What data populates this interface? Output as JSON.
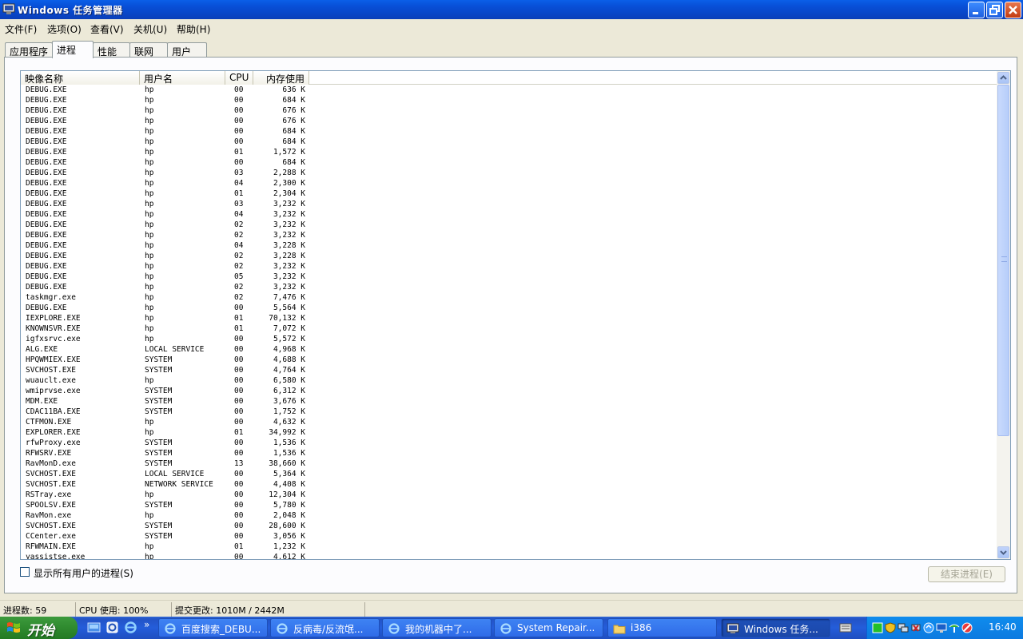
{
  "window": {
    "title": "Windows 任务管理器",
    "controls": [
      "minimize",
      "restore",
      "close"
    ]
  },
  "menu": [
    {
      "label": "文件(F)"
    },
    {
      "label": "选项(O)"
    },
    {
      "label": "查看(V)"
    },
    {
      "label": "关机(U)"
    },
    {
      "label": "帮助(H)"
    }
  ],
  "tabs": [
    {
      "label": "应用程序",
      "active": false
    },
    {
      "label": "进程",
      "active": true
    },
    {
      "label": "性能",
      "active": false
    },
    {
      "label": "联网",
      "active": false
    },
    {
      "label": "用户",
      "active": false
    }
  ],
  "process_table": {
    "columns": [
      "映像名称",
      "用户名",
      "CPU",
      "内存使用"
    ],
    "rows": [
      [
        "DEBUG.EXE",
        "hp",
        "00",
        "636 K"
      ],
      [
        "DEBUG.EXE",
        "hp",
        "00",
        "684 K"
      ],
      [
        "DEBUG.EXE",
        "hp",
        "00",
        "676 K"
      ],
      [
        "DEBUG.EXE",
        "hp",
        "00",
        "676 K"
      ],
      [
        "DEBUG.EXE",
        "hp",
        "00",
        "684 K"
      ],
      [
        "DEBUG.EXE",
        "hp",
        "00",
        "684 K"
      ],
      [
        "DEBUG.EXE",
        "hp",
        "01",
        "1,572 K"
      ],
      [
        "DEBUG.EXE",
        "hp",
        "00",
        "684 K"
      ],
      [
        "DEBUG.EXE",
        "hp",
        "03",
        "2,288 K"
      ],
      [
        "DEBUG.EXE",
        "hp",
        "04",
        "2,300 K"
      ],
      [
        "DEBUG.EXE",
        "hp",
        "01",
        "2,304 K"
      ],
      [
        "DEBUG.EXE",
        "hp",
        "03",
        "3,232 K"
      ],
      [
        "DEBUG.EXE",
        "hp",
        "04",
        "3,232 K"
      ],
      [
        "DEBUG.EXE",
        "hp",
        "02",
        "3,232 K"
      ],
      [
        "DEBUG.EXE",
        "hp",
        "02",
        "3,232 K"
      ],
      [
        "DEBUG.EXE",
        "hp",
        "04",
        "3,228 K"
      ],
      [
        "DEBUG.EXE",
        "hp",
        "02",
        "3,228 K"
      ],
      [
        "DEBUG.EXE",
        "hp",
        "02",
        "3,232 K"
      ],
      [
        "DEBUG.EXE",
        "hp",
        "05",
        "3,232 K"
      ],
      [
        "DEBUG.EXE",
        "hp",
        "02",
        "3,232 K"
      ],
      [
        "taskmgr.exe",
        "hp",
        "02",
        "7,476 K"
      ],
      [
        "DEBUG.EXE",
        "hp",
        "00",
        "5,564 K"
      ],
      [
        "IEXPLORE.EXE",
        "hp",
        "01",
        "70,132 K"
      ],
      [
        "KNOWNSVR.EXE",
        "hp",
        "01",
        "7,072 K"
      ],
      [
        "igfxsrvc.exe",
        "hp",
        "00",
        "5,572 K"
      ],
      [
        "ALG.EXE",
        "LOCAL SERVICE",
        "00",
        "4,968 K"
      ],
      [
        "HPQWMIEX.EXE",
        "SYSTEM",
        "00",
        "4,688 K"
      ],
      [
        "SVCHOST.EXE",
        "SYSTEM",
        "00",
        "4,764 K"
      ],
      [
        "wuauclt.exe",
        "hp",
        "00",
        "6,580 K"
      ],
      [
        "wmiprvse.exe",
        "SYSTEM",
        "00",
        "6,312 K"
      ],
      [
        "MDM.EXE",
        "SYSTEM",
        "00",
        "3,676 K"
      ],
      [
        "CDAC11BA.EXE",
        "SYSTEM",
        "00",
        "1,752 K"
      ],
      [
        "CTFMON.EXE",
        "hp",
        "00",
        "4,632 K"
      ],
      [
        "EXPLORER.EXE",
        "hp",
        "01",
        "34,992 K"
      ],
      [
        "rfwProxy.exe",
        "SYSTEM",
        "00",
        "1,536 K"
      ],
      [
        "RFWSRV.EXE",
        "SYSTEM",
        "00",
        "1,536 K"
      ],
      [
        "RavMonD.exe",
        "SYSTEM",
        "13",
        "38,660 K"
      ],
      [
        "SVCHOST.EXE",
        "LOCAL SERVICE",
        "00",
        "5,364 K"
      ],
      [
        "SVCHOST.EXE",
        "NETWORK SERVICE",
        "00",
        "4,408 K"
      ],
      [
        "RSTray.exe",
        "hp",
        "00",
        "12,304 K"
      ],
      [
        "SPOOLSV.EXE",
        "SYSTEM",
        "00",
        "5,780 K"
      ],
      [
        "RavMon.exe",
        "hp",
        "00",
        "2,048 K"
      ],
      [
        "SVCHOST.EXE",
        "SYSTEM",
        "00",
        "28,600 K"
      ],
      [
        "CCenter.exe",
        "SYSTEM",
        "00",
        "3,056 K"
      ],
      [
        "RFWMAIN.EXE",
        "hp",
        "01",
        "1,232 K"
      ],
      [
        "yassistse.exe",
        "hp",
        "00",
        "4,612 K"
      ]
    ]
  },
  "show_all_users": {
    "label": "显示所有用户的进程(S)",
    "checked": false
  },
  "end_process_button": {
    "label": "结束进程(E)",
    "enabled": false
  },
  "status_bar": {
    "processes": "进程数: 59",
    "cpu": "CPU 使用: 100%",
    "commit": "提交更改: 1010M / 2442M"
  },
  "taskbar": {
    "start_label": "开始",
    "quick_launch": [
      "show-desktop-icon",
      "outlook-icon",
      "ie-icon"
    ],
    "chevron": "»",
    "buttons": [
      {
        "label": "百度搜索_DEBU...",
        "icon": "ie-icon",
        "active": false
      },
      {
        "label": "反病毒/反流氓...",
        "icon": "ie-icon",
        "active": false
      },
      {
        "label": "我的机器中了...",
        "icon": "ie-icon",
        "active": false
      },
      {
        "label": "System Repair...",
        "icon": "ie-icon",
        "active": false
      },
      {
        "label": "i386",
        "icon": "folder-icon",
        "active": false
      },
      {
        "label": "Windows 任务...",
        "icon": "taskmgr-icon",
        "active": true
      }
    ],
    "clock": "16:40"
  },
  "colors": {
    "titlebar": "#0a5fe8",
    "taskbar": "#245dda",
    "start": "#2f8a2f",
    "tray": "#0f8ced",
    "face": "#ece9d8"
  }
}
